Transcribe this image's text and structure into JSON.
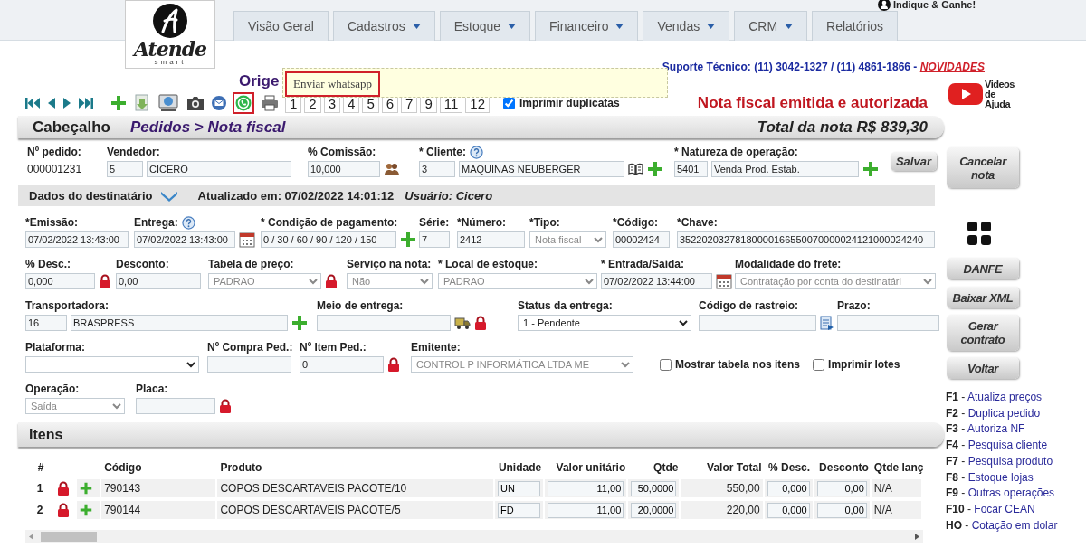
{
  "header": {
    "logo": {
      "name": "Atende",
      "tagline": "smart"
    },
    "referral": "Indique & Ganhe!",
    "tabs": [
      {
        "label": "Visão Geral",
        "has_menu": false
      },
      {
        "label": "Cadastros",
        "has_menu": true
      },
      {
        "label": "Estoque",
        "has_menu": true
      },
      {
        "label": "Financeiro",
        "has_menu": true
      },
      {
        "label": "Vendas",
        "has_menu": true
      },
      {
        "label": "CRM",
        "has_menu": true
      },
      {
        "label": "Relatórios",
        "has_menu": false
      }
    ],
    "support": {
      "text": "Suporte Técnico: (11) 3042-1327 / (11) 4861-1866 - ",
      "link": "NOVIDADES"
    },
    "help_video": {
      "line1": "Videos",
      "line2": "de Ajuda"
    }
  },
  "page_title": "Orige",
  "tooltip": {
    "text": "Enviar whatsapp"
  },
  "toolbar": {
    "pages": [
      "1",
      "2",
      "3",
      "4",
      "5",
      "6",
      "7",
      "9",
      "11",
      "12"
    ],
    "print_duplicates": {
      "label": "Imprimir duplicatas",
      "checked": true
    },
    "status": "Nota fiscal emitida e autorizada"
  },
  "header_bar": {
    "title": "Cabeçalho",
    "breadcrumb": "Pedidos > Nota fiscal",
    "total": "Total da nota R$ 839,30"
  },
  "order_fields": [
    {
      "kind": "field",
      "label": "Nº pedido:",
      "help": false,
      "parts": [
        {
          "kind": "text",
          "value": "000001231"
        }
      ]
    },
    {
      "kind": "field",
      "label": "Vendedor:",
      "help": false,
      "parts": [
        {
          "kind": "input",
          "value": "5"
        },
        {
          "kind": "input",
          "value": "CICERO"
        }
      ]
    },
    {
      "kind": "field",
      "label": "% Comissão:",
      "help": false,
      "parts": [
        {
          "kind": "input",
          "value": "10,000"
        },
        {
          "kind": "people"
        }
      ]
    },
    {
      "kind": "field",
      "label": "* Cliente:",
      "help": true,
      "parts": [
        {
          "kind": "input",
          "value": "3"
        },
        {
          "kind": "input",
          "value": "MAQUINAS NEUBERGER"
        },
        {
          "kind": "book"
        },
        {
          "kind": "plus"
        }
      ]
    },
    {
      "kind": "field",
      "label": "* Natureza de operação:",
      "help": false,
      "parts": [
        {
          "kind": "input",
          "value": "5401"
        },
        {
          "kind": "input",
          "value": "Venda Prod. Estab."
        },
        {
          "kind": "plus"
        }
      ]
    }
  ],
  "save_button": "Salvar",
  "recipient_bar": {
    "title": "Dados do destinatário",
    "updated": "Atualizado em: 07/02/2022 14:01:12",
    "user": "Usuário: Cicero"
  },
  "recipient_rows": [
    [
      {
        "kind": "field",
        "label": "*Emissão:",
        "help": false,
        "parts": [
          {
            "kind": "input",
            "value": "07/02/2022 13:43:00"
          }
        ]
      },
      {
        "kind": "field",
        "label": "Entrega:",
        "help": true,
        "parts": [
          {
            "kind": "input",
            "value": "07/02/2022 13:43:00"
          },
          {
            "kind": "calendar"
          }
        ]
      },
      {
        "kind": "field",
        "label": "* Condição de pagamento:",
        "help": false,
        "parts": [
          {
            "kind": "input",
            "value": "0 / 30 / 60 / 90 / 120 / 150"
          },
          {
            "kind": "plus"
          }
        ]
      },
      {
        "kind": "field",
        "label": "Série:",
        "help": false,
        "parts": [
          {
            "kind": "input",
            "value": "7"
          }
        ]
      },
      {
        "kind": "field",
        "label": "*Número:",
        "help": false,
        "parts": [
          {
            "kind": "input",
            "value": "2412"
          }
        ]
      },
      {
        "kind": "field",
        "label": "*Tipo:",
        "help": false,
        "parts": [
          {
            "kind": "select",
            "value": "Nota fiscal",
            "disabled": true
          }
        ]
      },
      {
        "kind": "field",
        "label": "*Código:",
        "help": false,
        "parts": [
          {
            "kind": "input",
            "value": "00002424"
          }
        ]
      },
      {
        "kind": "field",
        "label": "*Chave:",
        "help": false,
        "parts": [
          {
            "kind": "input",
            "value": "35220203278180000166550070000024121000024240"
          }
        ]
      }
    ],
    [
      {
        "kind": "field",
        "label": "% Desc.:",
        "help": false,
        "parts": [
          {
            "kind": "input",
            "value": "0,000"
          },
          {
            "kind": "lock"
          }
        ]
      },
      {
        "kind": "field",
        "label": "Desconto:",
        "help": false,
        "parts": [
          {
            "kind": "input",
            "value": "0,00"
          }
        ]
      },
      {
        "kind": "field",
        "label": "Tabela de preço:",
        "help": false,
        "parts": [
          {
            "kind": "select",
            "value": "PADRAO",
            "disabled": true
          },
          {
            "kind": "lock"
          }
        ]
      },
      {
        "kind": "field",
        "label": "Serviço na nota:",
        "help": false,
        "parts": [
          {
            "kind": "select",
            "value": "Não",
            "disabled": true
          }
        ]
      },
      {
        "kind": "field",
        "label": "* Local de estoque:",
        "help": false,
        "parts": [
          {
            "kind": "select",
            "value": "PADRAO",
            "disabled": true
          }
        ]
      },
      {
        "kind": "field",
        "label": "* Entrada/Saída:",
        "help": false,
        "parts": [
          {
            "kind": "input",
            "value": "07/02/2022 13:44:00"
          },
          {
            "kind": "calendar"
          }
        ]
      },
      {
        "kind": "field",
        "label": "Modalidade do frete:",
        "help": false,
        "parts": [
          {
            "kind": "select",
            "value": "Contratação por conta do destinatári",
            "disabled": true
          }
        ]
      }
    ],
    [
      {
        "kind": "field",
        "label": "Transportadora:",
        "help": false,
        "parts": [
          {
            "kind": "input",
            "value": "16"
          },
          {
            "kind": "input",
            "value": "BRASPRESS"
          },
          {
            "kind": "plus"
          }
        ]
      },
      {
        "kind": "field",
        "label": "Meio de entrega:",
        "help": false,
        "parts": [
          {
            "kind": "input"
          },
          {
            "kind": "truck"
          },
          {
            "kind": "lock"
          }
        ]
      },
      {
        "kind": "field",
        "label": "Status da entrega:",
        "help": false,
        "parts": [
          {
            "kind": "select",
            "value": "1 - Pendente",
            "disabled": false
          }
        ]
      },
      {
        "kind": "field",
        "label": "Código de rastreio:",
        "help": false,
        "parts": [
          {
            "kind": "input"
          },
          {
            "kind": "note"
          }
        ]
      },
      {
        "kind": "field",
        "label": "Prazo:",
        "help": false,
        "parts": [
          {
            "kind": "input"
          }
        ]
      }
    ],
    [
      {
        "kind": "field",
        "label": "Plataforma:",
        "help": false,
        "parts": [
          {
            "kind": "select",
            "disabled": false
          }
        ]
      },
      {
        "kind": "field",
        "label": "Nº Compra Ped.:",
        "help": false,
        "parts": [
          {
            "kind": "input"
          }
        ]
      },
      {
        "kind": "field",
        "label": "Nº Item Ped.:",
        "help": false,
        "parts": [
          {
            "kind": "input",
            "value": "0"
          },
          {
            "kind": "lock"
          }
        ]
      },
      {
        "kind": "field",
        "label": "Emitente:",
        "help": false,
        "parts": [
          {
            "kind": "select",
            "value": "CONTROL P INFORMÁTICA LTDA ME",
            "disabled": true
          }
        ]
      },
      {
        "kind": "checkbox",
        "label": "Mostrar tabela nos itens",
        "checked": false
      },
      {
        "kind": "checkbox",
        "label": "Imprimir lotes",
        "checked": false
      }
    ],
    [
      {
        "kind": "field",
        "label": "Operação:",
        "help": false,
        "parts": [
          {
            "kind": "select",
            "value": "Saída",
            "disabled": true
          }
        ]
      },
      {
        "kind": "field",
        "label": "Placa:",
        "help": false,
        "parts": [
          {
            "kind": "input"
          },
          {
            "kind": "lock"
          }
        ]
      }
    ]
  ],
  "items": {
    "title": "Itens",
    "columns": [
      "#",
      "Código",
      "Produto",
      "Unidade",
      "Valor unitário",
      "Qtde",
      "Valor Total",
      "% Desc.",
      "Desconto",
      "Qtde lanç"
    ],
    "rows": [
      {
        "number": "1",
        "code": "790143",
        "product": "COPOS DESCARTAVEIS PACOTE/10",
        "unit": "UN",
        "unit_price": "11,00",
        "qty": "50,0000",
        "total": "550,00",
        "disc_pct": "0,000",
        "discount": "0,00",
        "qty_launched": "N/A"
      },
      {
        "number": "2",
        "code": "790144",
        "product": "COPOS DESCARTAVEIS PACOTE/5",
        "unit": "FD",
        "unit_price": "11,00",
        "qty": "20,0000",
        "total": "220,00",
        "disc_pct": "0,000",
        "discount": "0,00",
        "qty_launched": "N/A"
      }
    ]
  },
  "sidebar": {
    "buttons": [
      "Cancelar nota",
      "DANFE",
      "Baixar XML",
      "Gerar contrato",
      "Voltar"
    ],
    "shortcuts": [
      {
        "key": "F1",
        "separator": "-",
        "action": "Atualiza preços"
      },
      {
        "key": "F2",
        "separator": "-",
        "action": "Duplica pedido"
      },
      {
        "key": "F3",
        "separator": "-",
        "action": "Autoriza NF"
      },
      {
        "key": "F4",
        "separator": "-",
        "action": "Pesquisa cliente"
      },
      {
        "key": "F7",
        "separator": "-",
        "action": "Pesquisa produto"
      },
      {
        "key": "F8",
        "separator": "-",
        "action": "Estoque lojas"
      },
      {
        "key": "F9",
        "separator": "-",
        "action": "Outras operações"
      },
      {
        "key": "F10",
        "separator": "-",
        "action": "Focar CEAN"
      },
      {
        "key": "HO",
        "separator": "-",
        "action": "Cotação em dolar"
      }
    ]
  }
}
